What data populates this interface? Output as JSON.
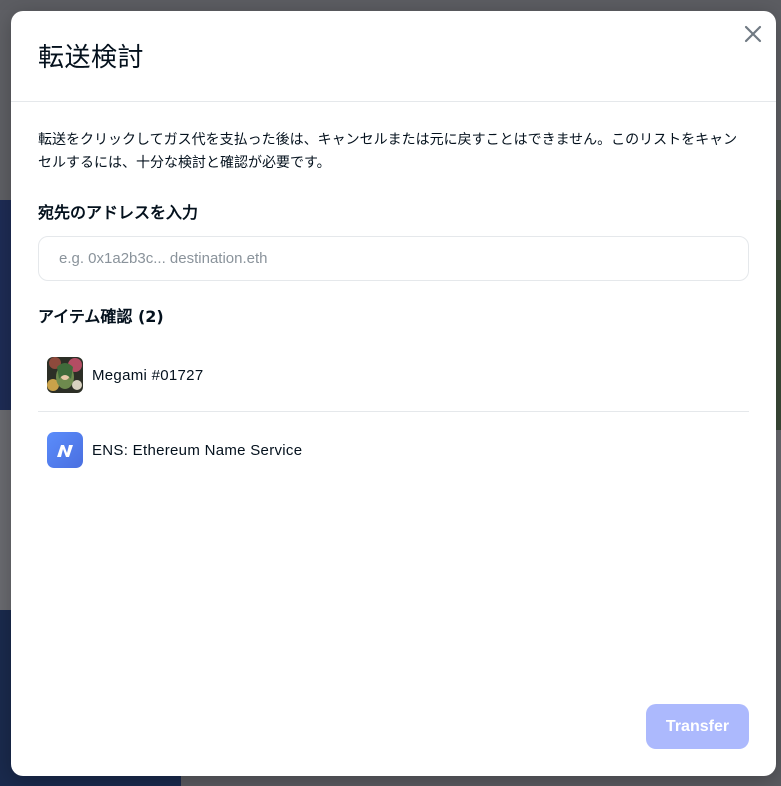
{
  "modal": {
    "title": "転送検討",
    "warning": "転送をクリックしてガス代を支払った後は、キャンセルまたは元に戻すことはできません。このリストをキャンセルするには、十分な検討と確認が必要です。",
    "address_label": "宛先のアドレスを入力",
    "address_input": {
      "value": "",
      "placeholder": "e.g. 0x1a2b3c... destination.eth"
    },
    "items_label": "アイテム確認 (2)",
    "items": [
      {
        "name": "Megami #01727",
        "icon": "megami-nft-thumbnail"
      },
      {
        "name": "ENS: Ethereum Name Service",
        "icon": "ens-logo-icon"
      }
    ],
    "transfer_label": "Transfer",
    "close_icon": "close-icon"
  },
  "colors": {
    "overlay": "#5f6065",
    "modal_bg": "#ffffff",
    "text": "#04111d",
    "placeholder": "#8a939b",
    "border": "#e5e8eb",
    "button_disabled": "#acb9fd",
    "ens_blue": "#5284ff"
  }
}
